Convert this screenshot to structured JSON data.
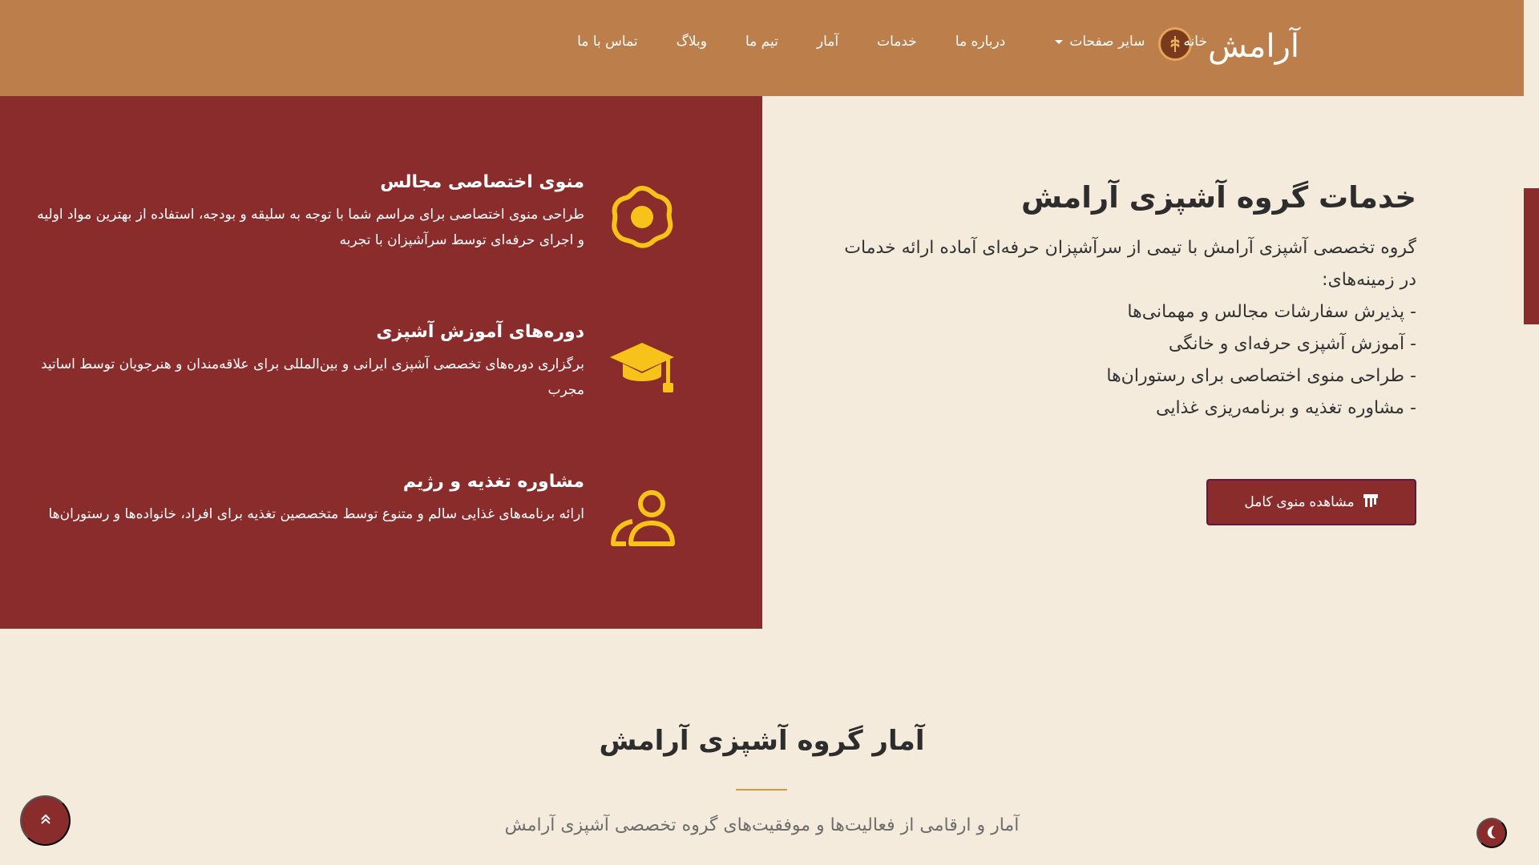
{
  "header": {
    "brand_name": "آرامش",
    "logo_icon": "wheat-logo-icon",
    "nav": {
      "home": "خانه",
      "other_pages": "سایر صفحات",
      "about": "درباره ما",
      "services": "خدمات",
      "stats": "آمار",
      "team": "تیم ما",
      "blog": "وبلاگ",
      "contact": "تماس با ما"
    }
  },
  "services": {
    "items": [
      {
        "title": "منوی اختصاصی مجالس",
        "desc": "طراحی منوی اختصاصی برای مراسم شما با توجه به سلیقه و بودجه، استفاده از بهترین مواد اولیه و اجرای حرفه‌ای توسط سرآشپزان با تجربه",
        "icon": "fried-egg-icon"
      },
      {
        "title": "دوره‌های آموزش آشپزی",
        "desc": "برگزاری دوره‌های تخصصی آشپزی ایرانی و بین‌المللی برای علاقه‌مندان و هنرجویان توسط اساتید مجرب",
        "icon": "graduation-cap-icon"
      },
      {
        "title": "مشاوره تغذیه و رژیم",
        "desc": "ارائه برنامه‌های غذایی سالم و متنوع توسط متخصصین تغذیه برای افراد، خانواده‌ها و رستوران‌ها",
        "icon": "users-icon"
      }
    ],
    "intro": {
      "title": "خدمات گروه آشپزی آرامش",
      "body": "گروه تخصصی آشپزی آرامش با تیمی از سرآشپزان حرفه‌ای آماده ارائه خدمات در زمینه‌های:",
      "list": [
        "- پذیرش سفارشات مجالس و مهمانی‌ها",
        "- آموزش آشپزی حرفه‌ای و خانگی",
        "- طراحی منوی اختصاصی برای رستوران‌ها",
        "- مشاوره تغذیه و برنامه‌ریزی غذایی"
      ],
      "cta_label": "مشاهده منوی کامل",
      "cta_icon": "menu-board-icon"
    }
  },
  "stats": {
    "title": "آمار گروه آشپزی آرامش",
    "subtitle": "آمار و ارقامی از فعالیت‌ها و موفقیت‌های گروه تخصصی آشپزی آرامش"
  },
  "floating": {
    "to_top_icon": "double-chevron-up-icon",
    "theme_icon": "moon-icon"
  },
  "colors": {
    "header_bg": "#bc7e4a",
    "panel_red": "#8b2c2c",
    "accent_yellow": "#f7c21a",
    "page_bg": "#f5ebdd"
  }
}
